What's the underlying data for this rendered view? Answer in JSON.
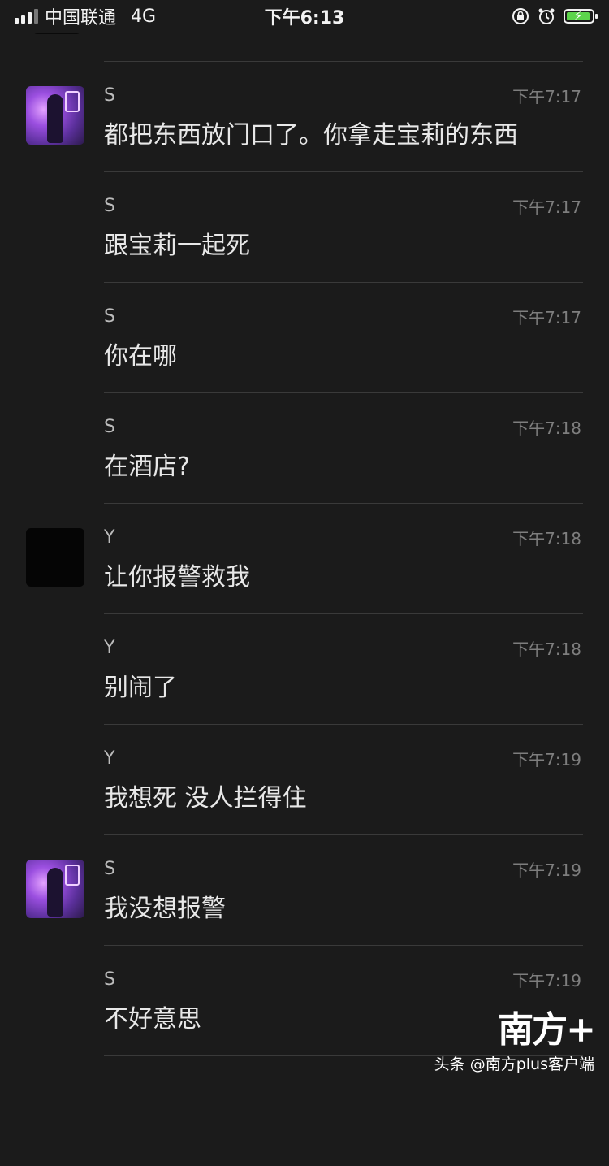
{
  "status_bar": {
    "carrier": "中国联通",
    "network": "4G",
    "time": "下午6:13"
  },
  "messages": [
    {
      "sender": "S",
      "time": "下午7:17",
      "text": "都把东西放门口了。你拿走宝莉的东西",
      "avatar": "purple"
    },
    {
      "sender": "S",
      "time": "下午7:17",
      "text": "跟宝莉一起死",
      "avatar": ""
    },
    {
      "sender": "S",
      "time": "下午7:17",
      "text": "你在哪",
      "avatar": ""
    },
    {
      "sender": "S",
      "time": "下午7:18",
      "text": "在酒店?",
      "avatar": ""
    },
    {
      "sender": "Y",
      "time": "下午7:18",
      "text": "让你报警救我",
      "avatar": "black"
    },
    {
      "sender": "Y",
      "time": "下午7:18",
      "text": "别闹了",
      "avatar": ""
    },
    {
      "sender": "Y",
      "time": "下午7:19",
      "text": "我想死 没人拦得住",
      "avatar": ""
    },
    {
      "sender": "S",
      "time": "下午7:19",
      "text": "我没想报警",
      "avatar": "purple"
    },
    {
      "sender": "S",
      "time": "下午7:19",
      "text": "不好意思",
      "avatar": ""
    }
  ],
  "watermark": {
    "logo": "南方+",
    "caption": "头条 @南方plus客户端"
  },
  "colors": {
    "background": "#1b1b1b",
    "divider": "#3a3a3a",
    "battery": "#5cd44b"
  }
}
